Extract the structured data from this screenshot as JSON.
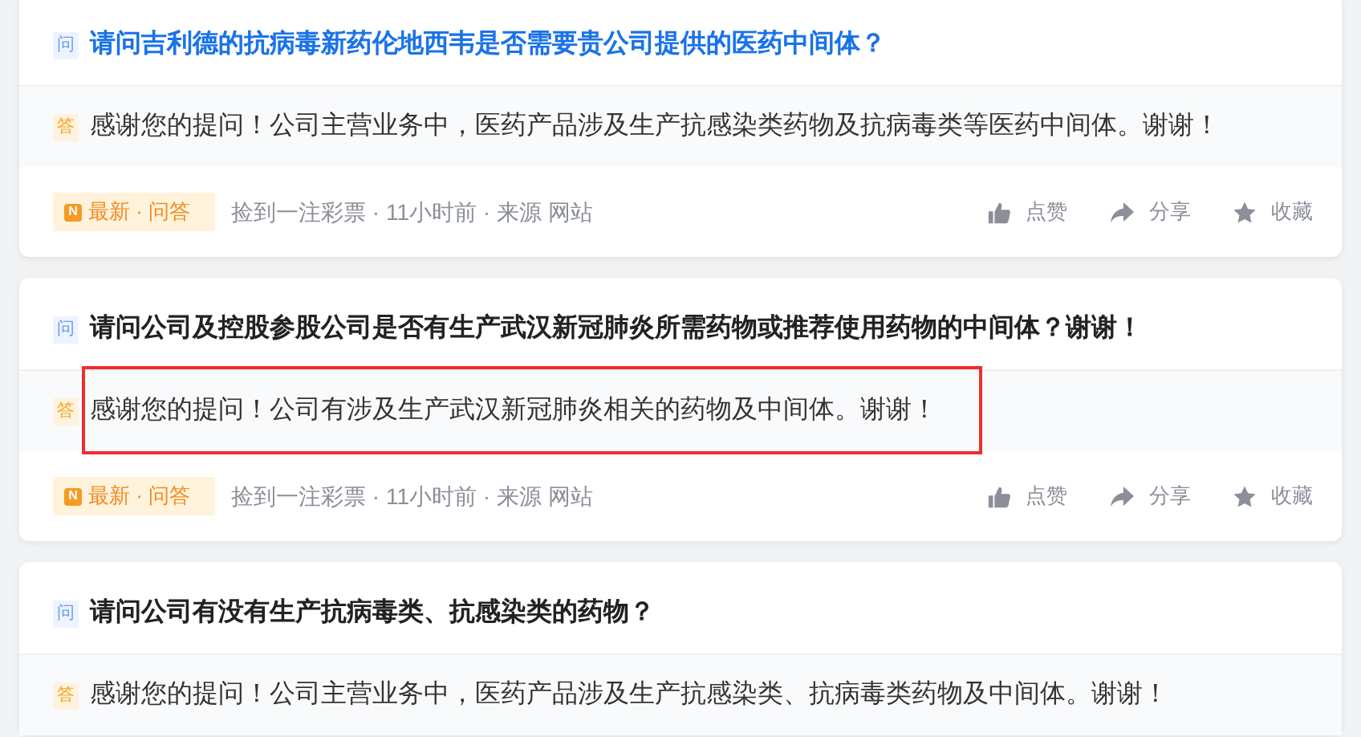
{
  "cards": [
    {
      "question": {
        "icon": "问",
        "text": "请问吉利德的抗病毒新药伦地西韦是否需要贵公司提供的医药中间体？",
        "highlighted": true
      },
      "answer": {
        "icon": "答",
        "text": "感谢您的提问！公司主营业务中，医药产品涉及生产抗感染类药物及抗病毒类等医药中间体。谢谢！",
        "boxed": false
      },
      "footer": {
        "badge": {
          "icon": "N",
          "text": "最新 · 问答"
        },
        "meta": "捡到一注彩票 · 11小时前 · 来源 网站",
        "actions": [
          {
            "kind": "like",
            "label": "点赞"
          },
          {
            "kind": "share",
            "label": "分享"
          },
          {
            "kind": "favorite",
            "label": "收藏"
          }
        ]
      }
    },
    {
      "question": {
        "icon": "问",
        "text": "请问公司及控股参股公司是否有生产武汉新冠肺炎所需药物或推荐使用药物的中间体？谢谢！",
        "highlighted": false
      },
      "answer": {
        "icon": "答",
        "text": "感谢您的提问！公司有涉及生产武汉新冠肺炎相关的药物及中间体。谢谢！",
        "boxed": true
      },
      "footer": {
        "badge": {
          "icon": "N",
          "text": "最新 · 问答"
        },
        "meta": "捡到一注彩票 · 11小时前 · 来源 网站",
        "actions": [
          {
            "kind": "like",
            "label": "点赞"
          },
          {
            "kind": "share",
            "label": "分享"
          },
          {
            "kind": "favorite",
            "label": "收藏"
          }
        ]
      }
    },
    {
      "question": {
        "icon": "问",
        "text": "请问公司有没有生产抗病毒类、抗感染类的药物？",
        "highlighted": false
      },
      "answer": {
        "icon": "答",
        "text": "感谢您的提问！公司主营业务中，医药产品涉及生产抗感染类、抗病毒类药物及中间体。谢谢！",
        "boxed": false
      }
    }
  ]
}
